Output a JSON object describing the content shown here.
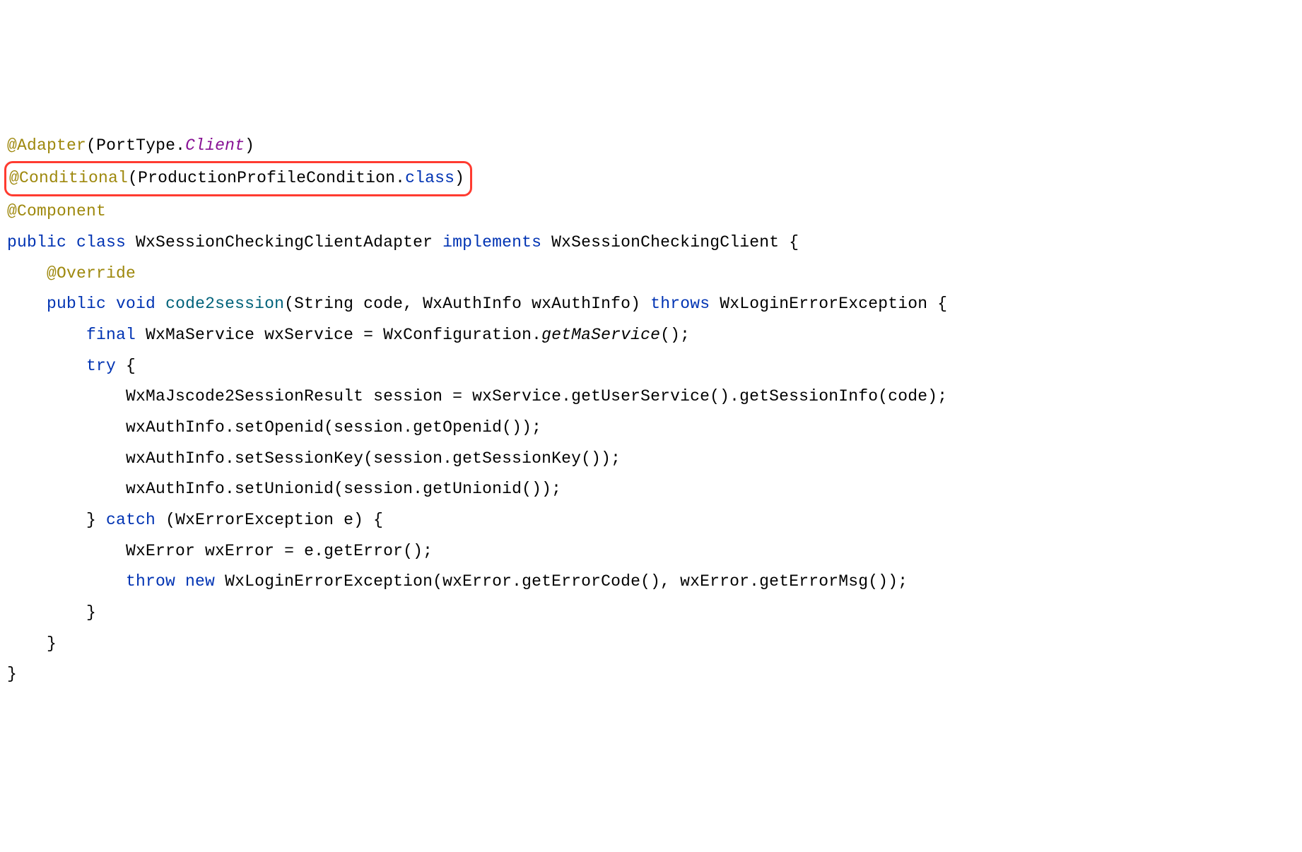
{
  "line1": {
    "at": "@",
    "adapter": "Adapter",
    "paren_open": "(",
    "porttype": "PortType.",
    "client": "Client",
    "paren_close": ")"
  },
  "line2": {
    "at": "@",
    "conditional": "Conditional",
    "paren_open": "(",
    "condition": "ProductionProfileCondition.",
    "class_kw": "class",
    "paren_close": ")"
  },
  "line3": {
    "at": "@",
    "component": "Component"
  },
  "line4": {
    "public": "public ",
    "class": "class ",
    "classname": "WxSessionCheckingClientAdapter ",
    "implements": "implements ",
    "interface": "WxSessionCheckingClient {"
  },
  "line5": {
    "indent": "    ",
    "at": "@",
    "override": "Override"
  },
  "line6": {
    "indent": "    ",
    "public": "public ",
    "void": "void ",
    "method": "code2session",
    "params": "(String code, WxAuthInfo wxAuthInfo) ",
    "throws": "throws ",
    "exception": "WxLoginErrorException {"
  },
  "line7": {
    "indent": "        ",
    "final": "final ",
    "text1": "WxMaService wxService = WxConfiguration.",
    "method_italic": "getMaService",
    "text2": "();"
  },
  "line8": {
    "indent": "        ",
    "try": "try ",
    "brace": "{"
  },
  "line9": {
    "indent": "            ",
    "text": "WxMaJscode2SessionResult session = wxService.getUserService().getSessionInfo(code);"
  },
  "line10": {
    "indent": "            ",
    "text": "wxAuthInfo.setOpenid(session.getOpenid());"
  },
  "line11": {
    "indent": "            ",
    "text": "wxAuthInfo.setSessionKey(session.getSessionKey());"
  },
  "line12": {
    "indent": "            ",
    "text": "wxAuthInfo.setUnionid(session.getUnionid());"
  },
  "line13": {
    "indent": "        ",
    "brace": "} ",
    "catch": "catch ",
    "params": "(WxErrorException e) {"
  },
  "line14": {
    "indent": "            ",
    "text": "WxError wxError = e.getError();"
  },
  "line15": {
    "indent": "            ",
    "throw": "throw ",
    "new": "new ",
    "text": "WxLoginErrorException(wxError.getErrorCode(), wxError.getErrorMsg());"
  },
  "line16": {
    "indent": "        ",
    "brace": "}"
  },
  "line17": {
    "indent": "    ",
    "brace": "}"
  },
  "line18": {
    "brace": "}"
  }
}
